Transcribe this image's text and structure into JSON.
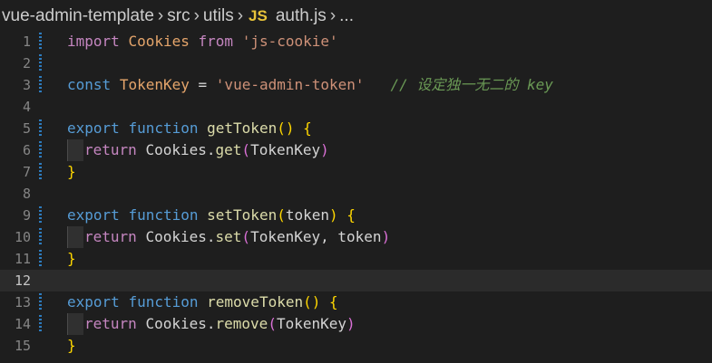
{
  "breadcrumb": {
    "items": [
      "vue-admin-template",
      "src",
      "utils"
    ],
    "file_icon": "JS",
    "file": "auth.js",
    "ellipsis": "..."
  },
  "editor": {
    "current_line": 12,
    "lines": [
      {
        "no": "1",
        "tokens": [
          [
            "import",
            "kw-purple"
          ],
          [
            " ",
            "plain"
          ],
          [
            "Cookies",
            "var-orange"
          ],
          [
            " ",
            "plain"
          ],
          [
            "from",
            "kw-purple"
          ],
          [
            " ",
            "plain"
          ],
          [
            "'js-cookie'",
            "str"
          ]
        ]
      },
      {
        "no": "2",
        "tokens": []
      },
      {
        "no": "3",
        "tokens": [
          [
            "const",
            "kw-blue"
          ],
          [
            " ",
            "plain"
          ],
          [
            "TokenKey",
            "var-orange"
          ],
          [
            " ",
            "plain"
          ],
          [
            "=",
            "plain"
          ],
          [
            " ",
            "plain"
          ],
          [
            "'vue-admin-token'",
            "str"
          ],
          [
            "   ",
            "plain"
          ],
          [
            "// 设定独一无二的 key",
            "comment"
          ]
        ]
      },
      {
        "no": "4",
        "tokens": []
      },
      {
        "no": "5",
        "tokens": [
          [
            "export",
            "kw-blue"
          ],
          [
            " ",
            "plain"
          ],
          [
            "function",
            "kw-blue"
          ],
          [
            " ",
            "plain"
          ],
          [
            "getToken",
            "fn"
          ],
          [
            "()",
            "paren-y"
          ],
          [
            " ",
            "plain"
          ],
          [
            "{",
            "brace-y"
          ]
        ]
      },
      {
        "no": "6",
        "tokens": [
          [
            "return",
            "kw-purple"
          ],
          [
            " ",
            "plain"
          ],
          [
            "Cookies",
            "plain"
          ],
          [
            ".",
            "plain"
          ],
          [
            "get",
            "fn"
          ],
          [
            "(",
            "paren-p"
          ],
          [
            "TokenKey",
            "plain"
          ],
          [
            ")",
            "paren-p"
          ]
        ]
      },
      {
        "no": "7",
        "tokens": [
          [
            "}",
            "brace-y"
          ]
        ]
      },
      {
        "no": "8",
        "tokens": []
      },
      {
        "no": "9",
        "tokens": [
          [
            "export",
            "kw-blue"
          ],
          [
            " ",
            "plain"
          ],
          [
            "function",
            "kw-blue"
          ],
          [
            " ",
            "plain"
          ],
          [
            "setToken",
            "fn"
          ],
          [
            "(",
            "paren-y"
          ],
          [
            "token",
            "plain"
          ],
          [
            ")",
            "paren-y"
          ],
          [
            " ",
            "plain"
          ],
          [
            "{",
            "brace-y"
          ]
        ]
      },
      {
        "no": "10",
        "tokens": [
          [
            "return",
            "kw-purple"
          ],
          [
            " ",
            "plain"
          ],
          [
            "Cookies",
            "plain"
          ],
          [
            ".",
            "plain"
          ],
          [
            "set",
            "fn"
          ],
          [
            "(",
            "paren-p"
          ],
          [
            "TokenKey, token",
            "plain"
          ],
          [
            ")",
            "paren-p"
          ]
        ]
      },
      {
        "no": "11",
        "tokens": [
          [
            "}",
            "brace-y"
          ]
        ]
      },
      {
        "no": "12",
        "tokens": []
      },
      {
        "no": "13",
        "tokens": [
          [
            "export",
            "kw-blue"
          ],
          [
            " ",
            "plain"
          ],
          [
            "function",
            "kw-blue"
          ],
          [
            " ",
            "plain"
          ],
          [
            "removeToken",
            "fn"
          ],
          [
            "()",
            "paren-y"
          ],
          [
            " ",
            "plain"
          ],
          [
            "{",
            "brace-y"
          ]
        ]
      },
      {
        "no": "14",
        "tokens": [
          [
            "return",
            "kw-purple"
          ],
          [
            " ",
            "plain"
          ],
          [
            "Cookies",
            "plain"
          ],
          [
            ".",
            "plain"
          ],
          [
            "remove",
            "fn"
          ],
          [
            "(",
            "paren-p"
          ],
          [
            "TokenKey",
            "plain"
          ],
          [
            ")",
            "paren-p"
          ]
        ]
      },
      {
        "no": "15",
        "tokens": [
          [
            "}",
            "brace-y"
          ]
        ]
      }
    ],
    "git_modified_lines": [
      1,
      2,
      3,
      5,
      6,
      7,
      9,
      10,
      11,
      13,
      14
    ],
    "indented_lines": [
      6,
      10,
      14
    ]
  },
  "colors": {
    "background": "#1e1e1e",
    "current_line": "#2b2b2b",
    "git_modified": "#2d7cbf"
  }
}
